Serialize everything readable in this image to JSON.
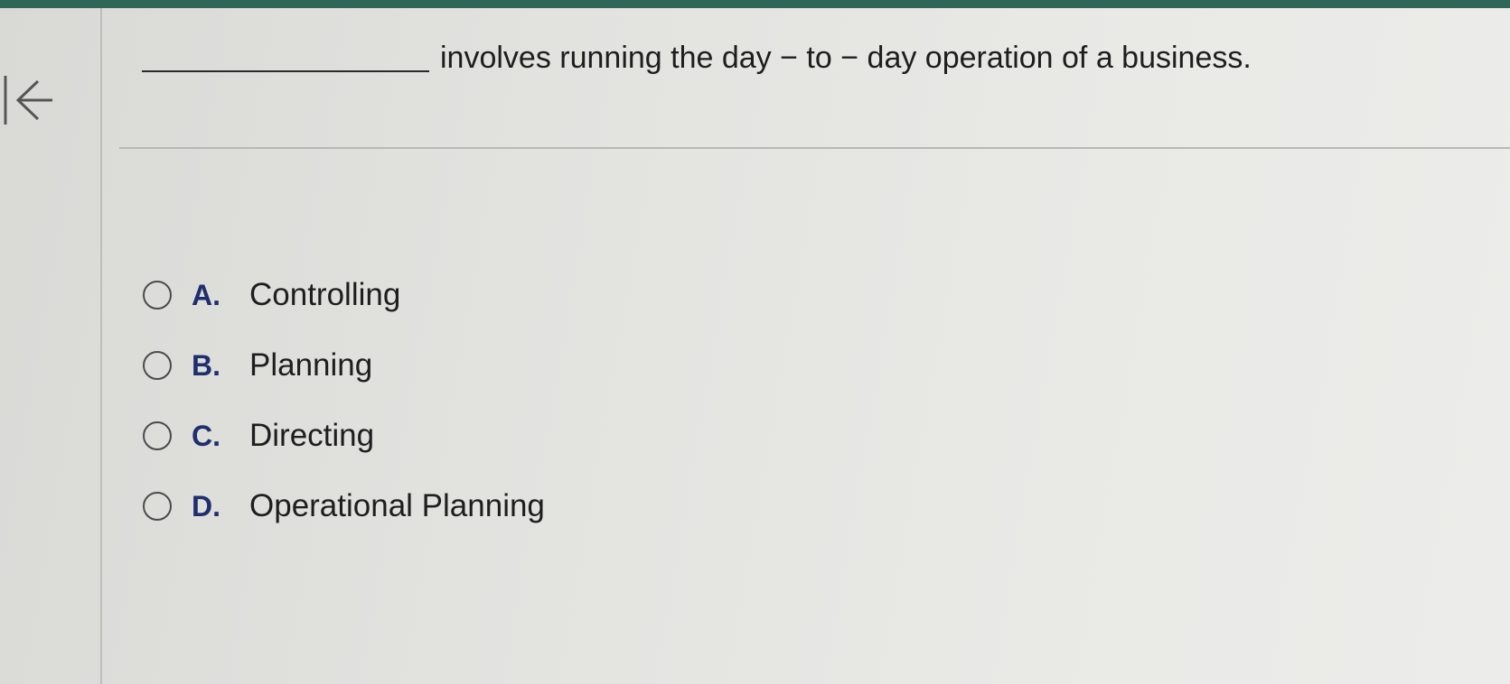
{
  "question": {
    "text": "involves running the day − to − day operation of a business."
  },
  "icons": {
    "back": "back-arrow-icon",
    "radio": "radio-unselected-icon"
  },
  "options": [
    {
      "letter": "A.",
      "text": "Controlling"
    },
    {
      "letter": "B.",
      "text": "Planning"
    },
    {
      "letter": "C.",
      "text": "Directing"
    },
    {
      "letter": "D.",
      "text": "Operational Planning"
    }
  ],
  "colors": {
    "top_band": "#2f6657",
    "option_letter": "#1f2f6e"
  }
}
